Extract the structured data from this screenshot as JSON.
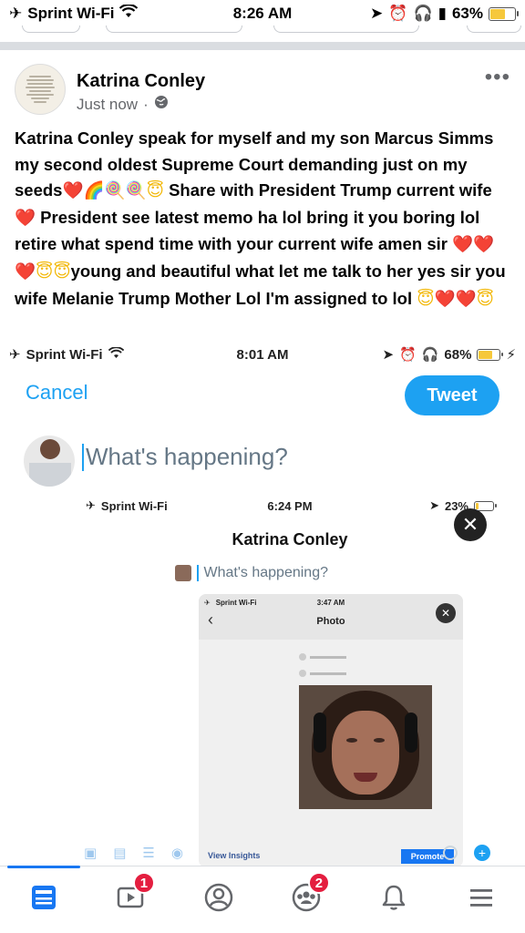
{
  "status_bar": {
    "carrier": "Sprint Wi-Fi",
    "time": "8:26 AM",
    "battery_percent": "63%",
    "battery_level": 0.63
  },
  "post": {
    "author": "Katrina Conley",
    "timestamp": "Just now",
    "privacy_icon": "globe-icon",
    "more_label": "•••",
    "text_name": "Katrina Conley",
    "text_1": " speak for myself and my son Marcus Simms my second oldest Supreme Court demanding just on my seeds",
    "text_2": " Share with President Trump current wife ",
    "text_3": " President see latest memo ha lol bring it you boring lol retire what spend time with your current wife amen sir ",
    "text_4": "young and beautiful what let me talk to her yes sir you wife Melanie Trump Mother Lol I'm assigned to lol ",
    "emoji": {
      "heart": "❤️",
      "rainbow": "🌈",
      "lollipop": "🍭",
      "angel": "😇"
    }
  },
  "embedded_tweet": {
    "status_bar": {
      "carrier": "Sprint Wi-Fi",
      "time": "8:01 AM",
      "battery_percent": "68%",
      "battery_level": 0.68
    },
    "cancel_label": "Cancel",
    "tweet_label": "Tweet",
    "compose_placeholder": "What's happening?",
    "nested": {
      "status_bar": {
        "carrier": "Sprint Wi-Fi",
        "time": "6:24 PM",
        "battery_percent": "23%",
        "battery_level": 0.23
      },
      "title": "Katrina Conley",
      "compose_placeholder": "What's happening?",
      "inner": {
        "status_bar": {
          "carrier": "Sprint Wi-Fi",
          "time": "3:47 AM"
        },
        "title": "Photo",
        "view_insights": "View Insights",
        "promote": "Promote"
      }
    }
  },
  "bottom_nav": {
    "items": [
      {
        "name": "home",
        "active": true
      },
      {
        "name": "watch",
        "badge": "1"
      },
      {
        "name": "profile"
      },
      {
        "name": "groups",
        "badge": "2"
      },
      {
        "name": "notifications"
      },
      {
        "name": "menu"
      }
    ]
  },
  "colors": {
    "facebook_blue": "#1877f2",
    "twitter_blue": "#1da1f2",
    "badge_red": "#e41e3f",
    "heart_red": "#e0245e"
  }
}
